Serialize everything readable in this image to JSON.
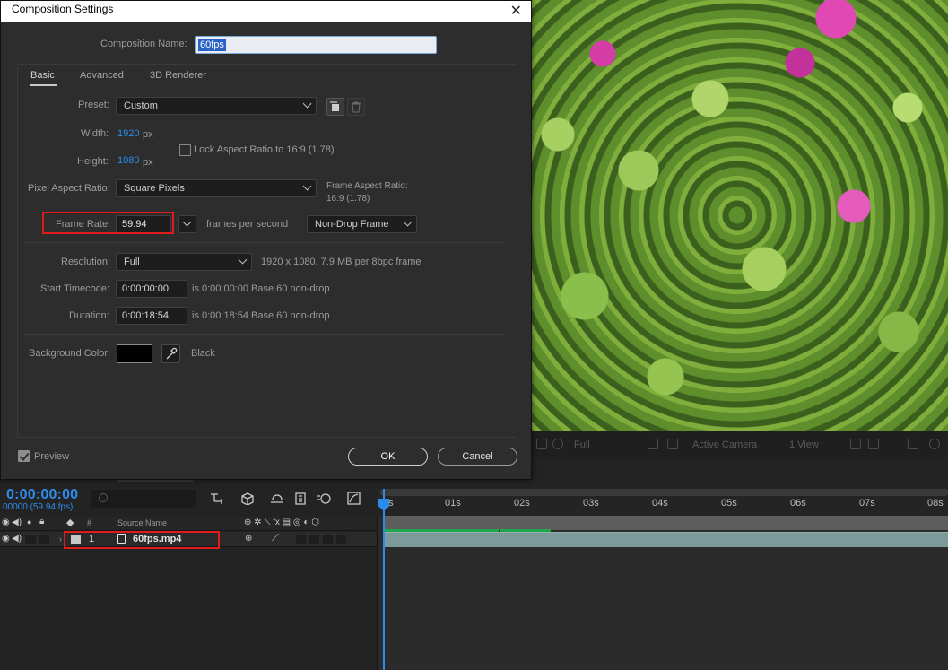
{
  "dialog": {
    "title": "Composition Settings",
    "close_glyph": "✕",
    "comp_name_label": "Composition Name:",
    "comp_name_value": "60fps",
    "tabs": [
      "Basic",
      "Advanced",
      "3D Renderer"
    ],
    "preset_label": "Preset:",
    "preset_value": "Custom",
    "width_label": "Width:",
    "width_value": "1920",
    "width_unit": "px",
    "height_label": "Height:",
    "height_value": "1080",
    "height_unit": "px",
    "lock_aspect_label": "Lock Aspect Ratio to 16:9 (1.78)",
    "par_label": "Pixel Aspect Ratio:",
    "par_value": "Square Pixels",
    "frame_aspect_label": "Frame Aspect Ratio:",
    "frame_aspect_value": "16:9 (1.78)",
    "frame_rate_label": "Frame Rate:",
    "frame_rate_value": "59.94",
    "frames_per_second": "frames per second",
    "drop_frame_value": "Non-Drop Frame",
    "resolution_label": "Resolution:",
    "resolution_value": "Full",
    "resolution_info": "1920 x 1080, 7.9 MB per 8bpc frame",
    "start_tc_label": "Start Timecode:",
    "start_tc_value": "0:00:00:00",
    "start_tc_info": "is 0:00:00:00  Base 60  non-drop",
    "duration_label": "Duration:",
    "duration_value": "0:00:18:54",
    "duration_info": "is 0:00:18:54  Base 60  non-drop",
    "bg_color_label": "Background Color:",
    "bg_color_name": "Black",
    "preview_label": "Preview",
    "ok_label": "OK",
    "cancel_label": "Cancel"
  },
  "viewer_bar": {
    "zoom": "Full",
    "camera": "Active Camera",
    "views": "1 View"
  },
  "timeline": {
    "timecode": "0:00:00:00",
    "frame_info": "00000 (59.94 fps)",
    "hash_col": "#",
    "source_name_col": "Source Name",
    "ruler_ticks": [
      "0s",
      "01s",
      "02s",
      "03s",
      "04s",
      "05s",
      "06s",
      "07s",
      "08s"
    ],
    "layer_index": "1",
    "layer_name": "60fps.mp4"
  },
  "colors": {
    "accent_blue": "#2d8ceb",
    "highlight_red": "#e01b1b",
    "work_area_green": "#1fa84a",
    "layer_bar": "#7d9a9a"
  },
  "icons": [
    "close-icon",
    "chevron-down-icon",
    "new-preset-icon",
    "delete-preset-icon",
    "eyedropper-icon",
    "checkbox-icon",
    "search-icon",
    "eye-icon",
    "audio-icon",
    "solo-icon",
    "lock-icon",
    "label-icon",
    "footage-icon"
  ]
}
